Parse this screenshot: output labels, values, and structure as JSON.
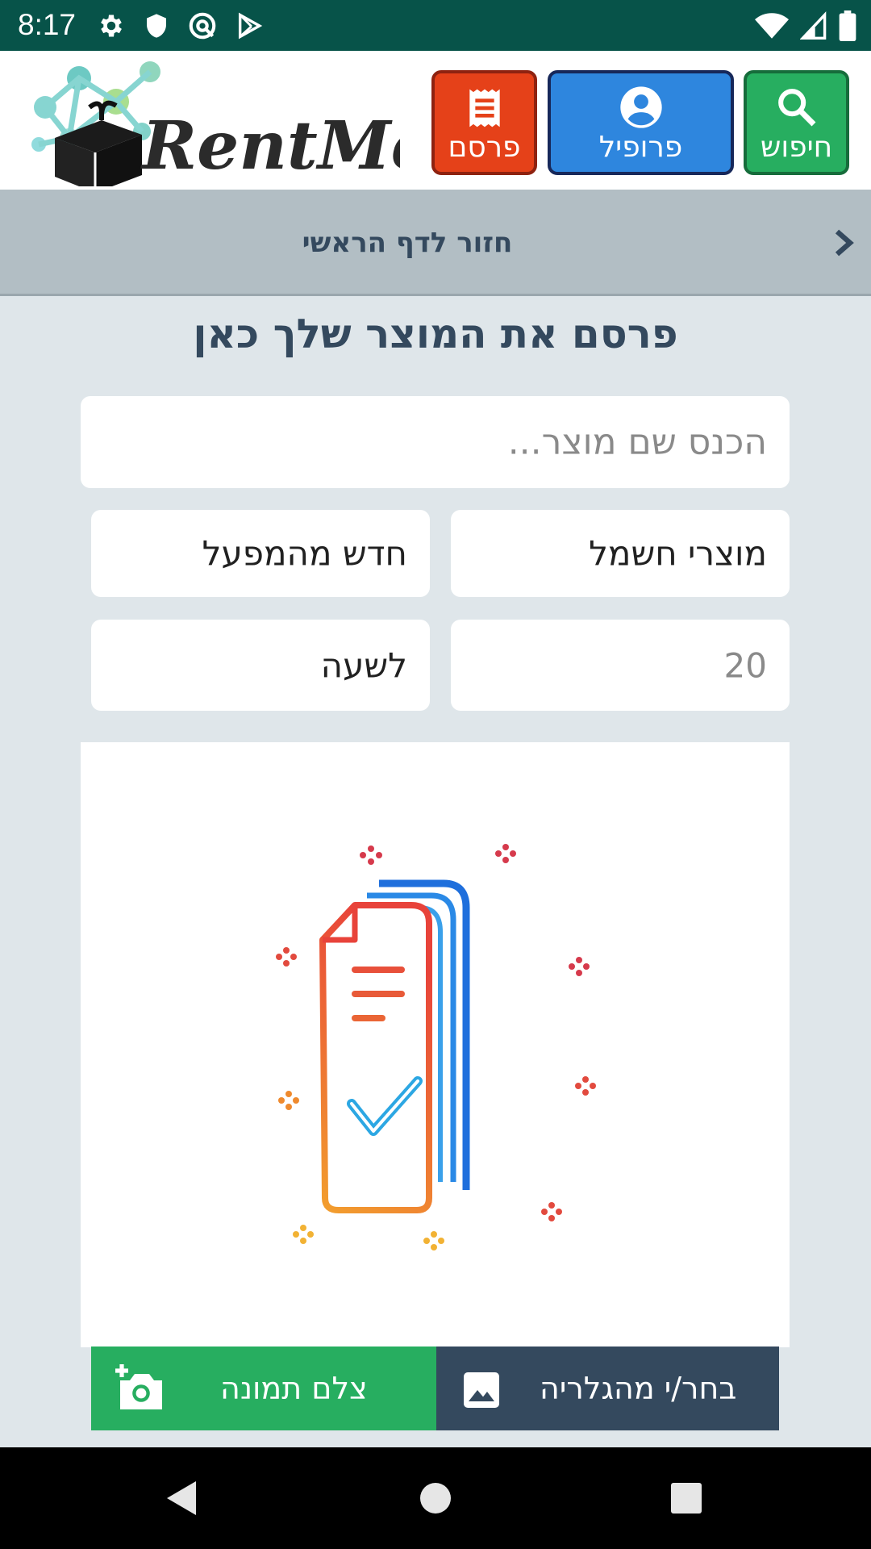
{
  "status_bar": {
    "time": "8:17",
    "left_icons": [
      "settings-gear-icon",
      "shield-icon",
      "vpn-at-icon",
      "play-store-icon"
    ],
    "right_icons": [
      "wifi-icon",
      "cell-signal-icon",
      "battery-icon"
    ]
  },
  "header": {
    "logo_text": "RentMe",
    "buttons": [
      {
        "label": "פרסם",
        "icon": "receipt-icon",
        "color": "#e54119"
      },
      {
        "label": "פרופיל",
        "icon": "account-circle-icon",
        "color": "#2e86de"
      },
      {
        "label": "חיפוש",
        "icon": "search-icon",
        "color": "#27ae60"
      }
    ]
  },
  "back_bar": {
    "label": "חזור לדף הראשי",
    "icon": "chevron-right-icon"
  },
  "form": {
    "title": "פרסם את המוצר שלך כאן",
    "name_placeholder": "הכנס שם מוצר...",
    "category_value": "מוצרי חשמל",
    "condition_value": "חדש מהמפעל",
    "price_placeholder": "20",
    "period_value": "לשעה"
  },
  "image_preview": {
    "icon": "document-checkmark-illustration"
  },
  "actions": {
    "camera_label": "צלם תמונה",
    "camera_icon": "add-photo-camera-icon",
    "gallery_label": "בחר/י מהגלריה",
    "gallery_icon": "image-icon"
  },
  "nav_bar": {
    "icons": [
      "back-triangle-icon",
      "home-circle-icon",
      "recents-square-icon"
    ]
  },
  "colors": {
    "status_bar": "#075349",
    "publish": "#e54119",
    "profile": "#2e86de",
    "search": "#27ae60",
    "dark_slate": "#34495e",
    "page_bg": "#dfe6ea"
  }
}
